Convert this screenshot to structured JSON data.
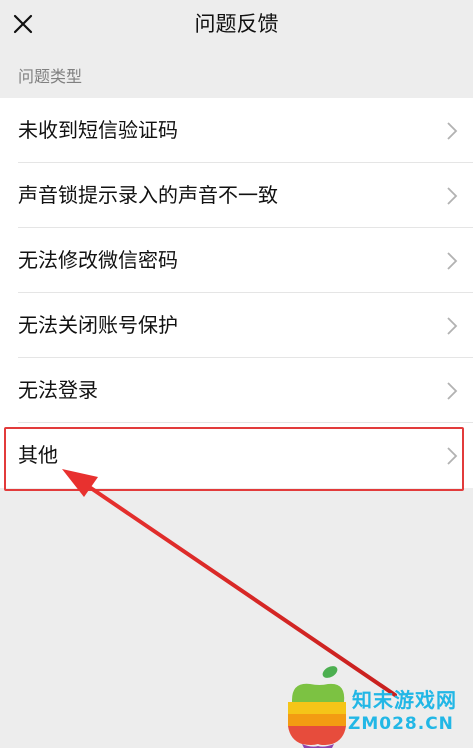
{
  "header": {
    "title": "问题反馈",
    "close_icon": "close-icon"
  },
  "section": {
    "title": "问题类型"
  },
  "items": [
    {
      "label": "未收到短信验证码"
    },
    {
      "label": "声音锁提示录入的声音不一致"
    },
    {
      "label": "无法修改微信密码"
    },
    {
      "label": "无法关闭账号保护"
    },
    {
      "label": "无法登录"
    },
    {
      "label": "其他"
    }
  ],
  "annotation": {
    "highlighted_item": "其他",
    "color": "#e23b3b"
  },
  "watermark": {
    "cn": "知末游戏网",
    "en": "ZM028.CN",
    "color": "#22b7e6"
  }
}
